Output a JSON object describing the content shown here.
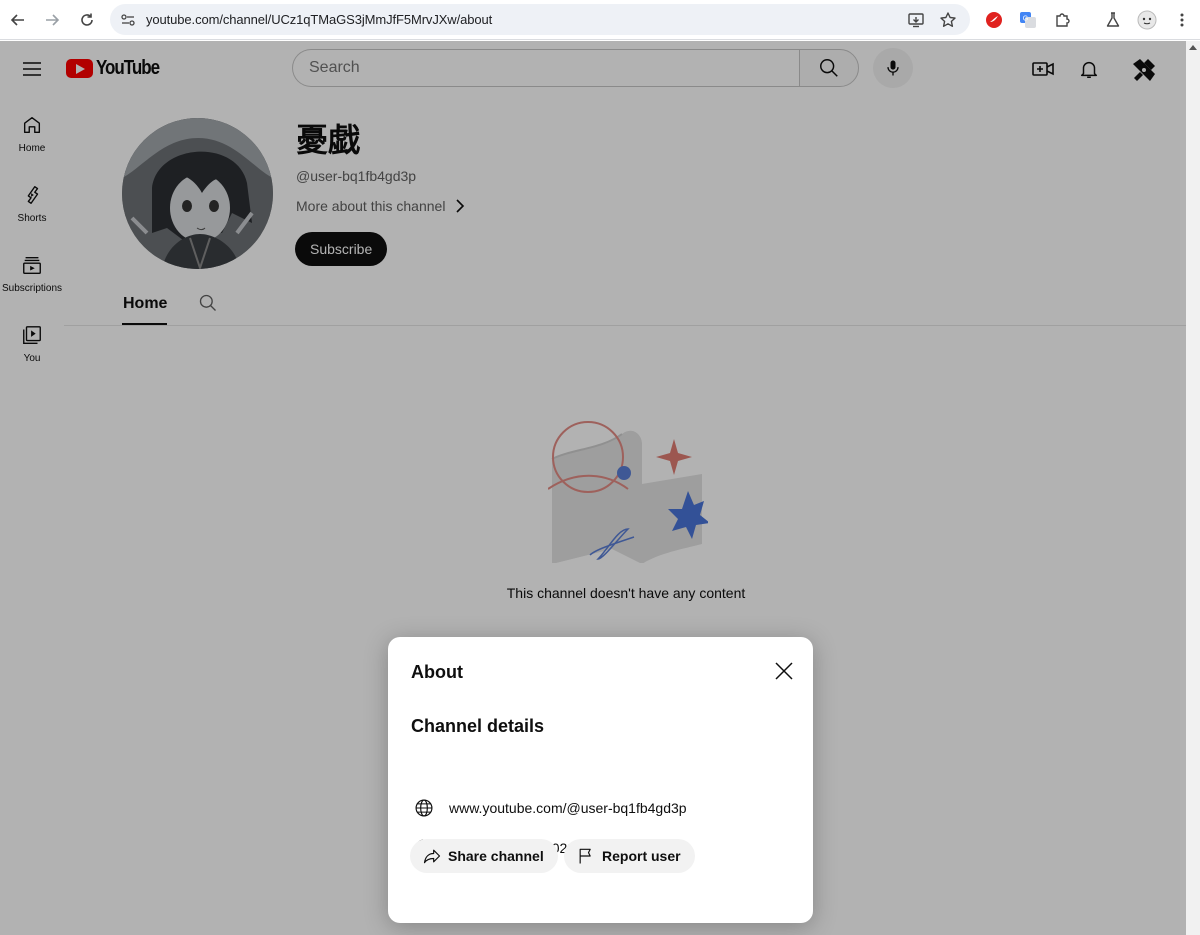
{
  "browser": {
    "url": "youtube.com/channel/UCz1qTMaGS3jMmJfF5MrvJXw/about"
  },
  "youtube": {
    "logo_text": "YouTube",
    "search": {
      "placeholder": "Search"
    },
    "guide": [
      {
        "label": "Home",
        "icon": "home-icon"
      },
      {
        "label": "Shorts",
        "icon": "shorts-icon"
      },
      {
        "label": "Subscriptions",
        "icon": "subscriptions-icon"
      },
      {
        "label": "You",
        "icon": "you-icon"
      }
    ]
  },
  "channel": {
    "name": "憂戯",
    "handle": "@user-bq1fb4gd3p",
    "more_about": "More about this channel",
    "subscribe_label": "Subscribe",
    "tabs": [
      {
        "label": "Home",
        "selected": true
      }
    ],
    "empty_message": "This channel doesn't have any content"
  },
  "about_dialog": {
    "title": "About",
    "section_title": "Channel details",
    "details": [
      {
        "icon": "globe-icon",
        "text": "www.youtube.com/@user-bq1fb4gd3p"
      },
      {
        "icon": "info-icon",
        "text": "Joined Jan 29, 2023"
      }
    ],
    "actions": [
      {
        "label": "Share channel",
        "icon": "share-icon"
      },
      {
        "label": "Report user",
        "icon": "flag-icon"
      }
    ]
  },
  "colors": {
    "youtube_red": "#ff0000",
    "text_primary": "#0f0f0f",
    "text_secondary": "#606060",
    "pill_bg": "#f2f2f2",
    "overlay": "rgba(0,0,0,0.30)"
  }
}
